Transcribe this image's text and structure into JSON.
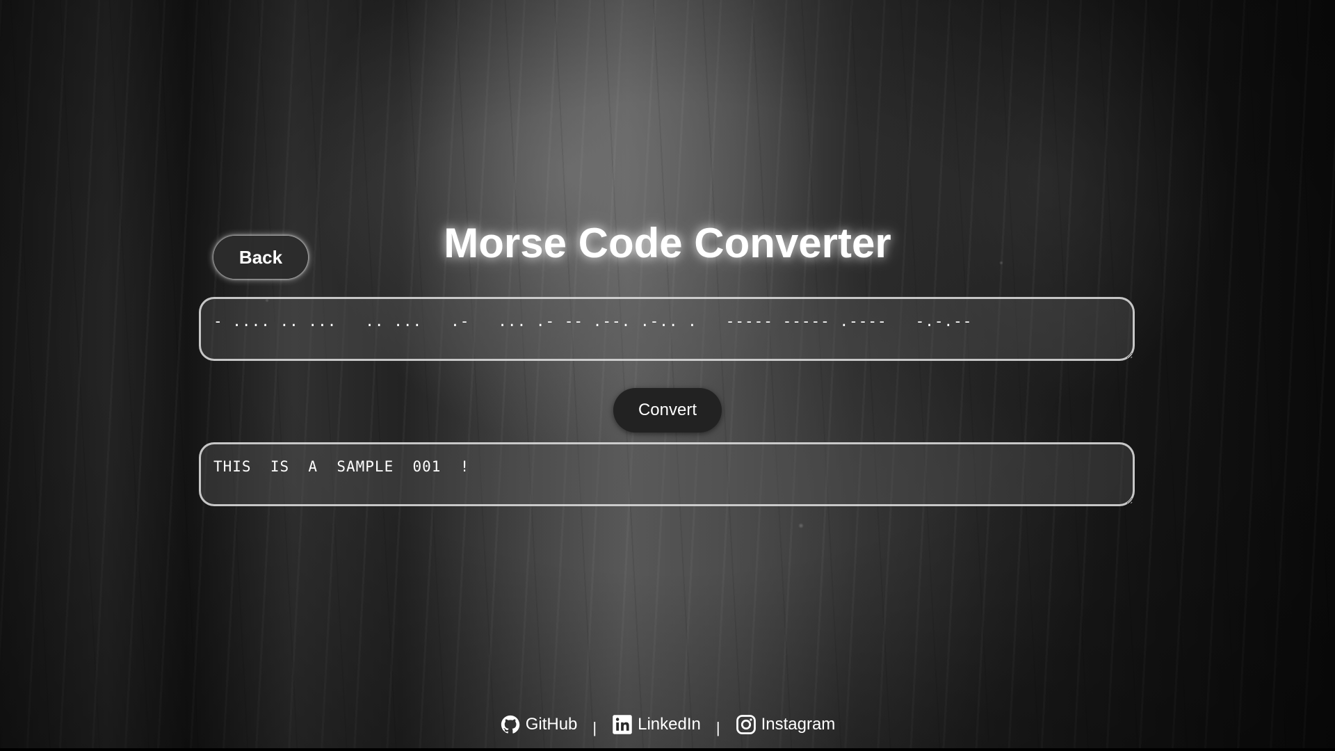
{
  "page": {
    "title": "Morse Code Converter"
  },
  "back_button": {
    "label": "Back"
  },
  "morse_input": {
    "value": "- .... .. ...   .. ...   .-   ... .- -- .--. .-.. .   ----- ----- .----   -.-.--"
  },
  "convert_button": {
    "label": "Convert"
  },
  "text_output": {
    "value": "THIS  IS  A  SAMPLE  001  !"
  },
  "footer": {
    "links": [
      {
        "label": "GitHub",
        "icon": "github-icon"
      },
      {
        "label": "LinkedIn",
        "icon": "linkedin-icon"
      },
      {
        "label": "Instagram",
        "icon": "instagram-icon"
      }
    ],
    "separator": "|"
  },
  "colors": {
    "text": "#ffffff",
    "button_bg": "#222222",
    "box_border": "#e1e1e1"
  }
}
